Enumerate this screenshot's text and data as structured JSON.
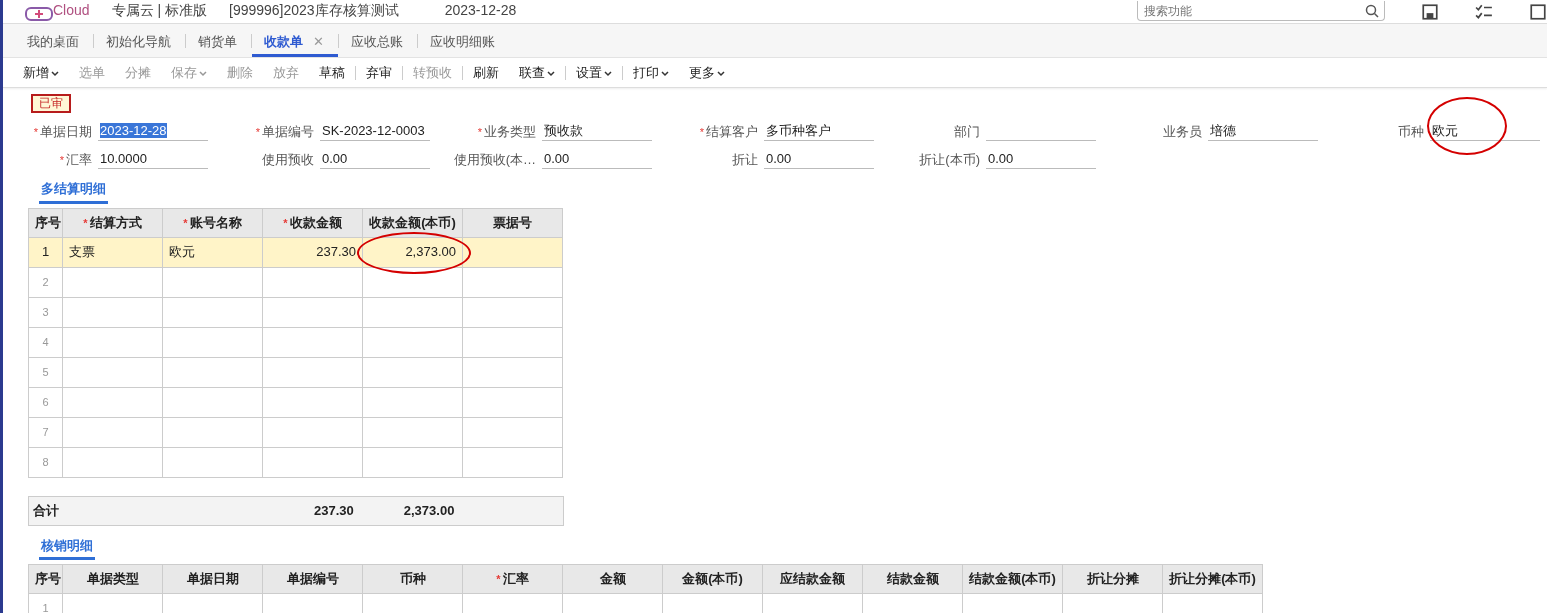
{
  "header": {
    "logo": "Cloud",
    "edition": "专属云 | 标准版",
    "account": "[999996]2023库存核算测试",
    "date": "2023-12-28",
    "search": {
      "placeholder": "搜索功能"
    }
  },
  "tabs": [
    {
      "label": "我的桌面",
      "selected": false,
      "closable": false
    },
    {
      "label": "初始化导航",
      "selected": false,
      "closable": false
    },
    {
      "label": "销货单",
      "selected": false,
      "closable": false
    },
    {
      "label": "收款单",
      "selected": true,
      "closable": true,
      "close": "✕"
    },
    {
      "label": "应收总账",
      "selected": false,
      "closable": false
    },
    {
      "label": "应收明细账",
      "selected": false,
      "closable": false
    }
  ],
  "toolbar": [
    {
      "label": "新增",
      "disabled": false,
      "dropdown": true,
      "divider": false
    },
    {
      "label": "选单",
      "disabled": true,
      "dropdown": false,
      "divider": false
    },
    {
      "label": "分摊",
      "disabled": true,
      "dropdown": false,
      "divider": false
    },
    {
      "label": "保存",
      "disabled": true,
      "dropdown": true,
      "divider": false
    },
    {
      "label": "删除",
      "disabled": true,
      "dropdown": false,
      "divider": false
    },
    {
      "label": "放弃",
      "disabled": true,
      "dropdown": false,
      "divider": false
    },
    {
      "label": "草稿",
      "disabled": false,
      "dropdown": false,
      "divider": true
    },
    {
      "label": "弃审",
      "disabled": false,
      "dropdown": false,
      "divider": true
    },
    {
      "label": "转预收",
      "disabled": true,
      "dropdown": false,
      "divider": true
    },
    {
      "label": "刷新",
      "disabled": false,
      "dropdown": false,
      "divider": false
    },
    {
      "label": "联查",
      "disabled": false,
      "dropdown": true,
      "divider": true
    },
    {
      "label": "设置",
      "disabled": false,
      "dropdown": true,
      "divider": true
    },
    {
      "label": "打印",
      "disabled": false,
      "dropdown": true,
      "divider": false
    },
    {
      "label": "更多",
      "disabled": false,
      "dropdown": true,
      "divider": false
    }
  ],
  "status_badge": "已审",
  "form": {
    "rows": [
      [
        {
          "label": "单据日期",
          "required_mark": "*",
          "value": "2023-12-28",
          "highlighted": true,
          "circled": false
        },
        {
          "label": "单据编号",
          "required_mark": "*",
          "value": "SK-2023-12-0003",
          "highlighted": false,
          "circled": false
        },
        {
          "label": "业务类型",
          "required_mark": "*",
          "value": "预收款",
          "highlighted": false,
          "circled": false
        },
        {
          "label": "结算客户",
          "required_mark": "*",
          "value": "多币种客户",
          "highlighted": false,
          "circled": false
        },
        {
          "label": "部门",
          "circled": false
        },
        {
          "label": "业务员",
          "value": "培德",
          "highlighted": false,
          "circled": false
        },
        {
          "label": "币种",
          "value": "欧元",
          "highlighted": false,
          "circled": true
        }
      ],
      [
        {
          "label": "汇率",
          "required_mark": "*",
          "value": "10.0000",
          "highlighted": false,
          "circled": false
        },
        {
          "label": "使用预收",
          "value": "0.00",
          "highlighted": false,
          "circled": false
        },
        {
          "label": "使用预收(本…",
          "value": "0.00",
          "highlighted": false,
          "circled": false
        },
        {
          "label": "折让",
          "value": "0.00",
          "highlighted": false,
          "circled": false
        },
        {
          "label": "折让(本币)",
          "value": "0.00",
          "highlighted": false,
          "circled": false
        }
      ]
    ]
  },
  "settlement": {
    "title": "多结算明细",
    "columns": [
      {
        "label": "序号"
      },
      {
        "label": "结算方式",
        "required_mark": "*"
      },
      {
        "label": "账号名称",
        "required_mark": "*"
      },
      {
        "label": "收款金额",
        "required_mark": "*"
      },
      {
        "label": "收款金额(本币)"
      },
      {
        "label": "票据号"
      }
    ],
    "rows": [
      {
        "seq": "1",
        "cells": [
          "支票",
          "欧元",
          "237.30",
          "2,373.00"
        ],
        "circled": [
          false,
          false,
          false,
          true
        ],
        "selected": true
      },
      {
        "seq": "2",
        "selected": false
      },
      {
        "seq": "3",
        "selected": false
      },
      {
        "seq": "4",
        "selected": false
      },
      {
        "seq": "5",
        "selected": false
      },
      {
        "seq": "6",
        "selected": false
      },
      {
        "seq": "7",
        "selected": false
      },
      {
        "seq": "8",
        "selected": false
      }
    ],
    "total": {
      "label": "合计",
      "amount": "237.30",
      "amount_local": "2,373.00"
    }
  },
  "writeoff": {
    "title": "核销明细",
    "columns": [
      {
        "label": "序号"
      },
      {
        "label": "单据类型"
      },
      {
        "label": "单据日期"
      },
      {
        "label": "单据编号"
      },
      {
        "label": "币种"
      },
      {
        "label": "汇率",
        "required_mark": "*"
      },
      {
        "label": "金额"
      },
      {
        "label": "金额(本币)"
      },
      {
        "label": "应结款金额"
      },
      {
        "label": "结款金额"
      },
      {
        "label": "结款金额(本币)"
      },
      {
        "label": "折让分摊"
      },
      {
        "label": "折让分摊(本币)"
      }
    ],
    "rows": [
      {
        "seq": "1",
        "selected": false
      }
    ]
  }
}
